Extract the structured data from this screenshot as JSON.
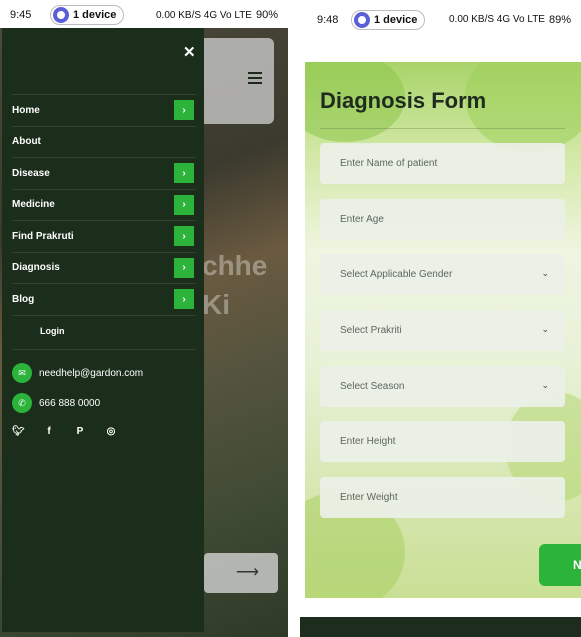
{
  "left": {
    "status": {
      "time": "9:45",
      "device": "1 device",
      "signal": "0.00 KB/S  4G  Vo  LTE",
      "battery": "90%"
    },
    "drawer": {
      "close_icon": "close-icon",
      "items": [
        {
          "label": "Home",
          "has_chevron": true
        },
        {
          "label": "About",
          "has_chevron": false
        },
        {
          "label": "Disease",
          "has_chevron": true
        },
        {
          "label": "Medicine",
          "has_chevron": true
        },
        {
          "label": "Find Prakruti",
          "has_chevron": true
        },
        {
          "label": "Diagnosis",
          "has_chevron": true
        },
        {
          "label": "Blog",
          "has_chevron": true
        }
      ],
      "chevron_glyph": "›",
      "login": "Login",
      "email": "needhelp@gardon.com",
      "phone": "666 888 0000",
      "socials": [
        "twitter-icon",
        "facebook-icon",
        "pinterest-icon",
        "instagram-icon"
      ]
    },
    "background_text": "chhe\nKi",
    "accent": "#2bb33a",
    "drawer_color": "#1b2d1b"
  },
  "right": {
    "status": {
      "time": "9:48",
      "device": "1 device",
      "signal": "0.00 KB/S  4G  Vo  LTE",
      "battery": "89%"
    },
    "form": {
      "title": "Diagnosis Form",
      "fields": [
        {
          "placeholder": "Enter Name of patient",
          "type": "input"
        },
        {
          "placeholder": "Enter Age",
          "type": "input"
        },
        {
          "placeholder": "Select Applicable Gender",
          "type": "select"
        },
        {
          "placeholder": "Select Prakriti",
          "type": "select"
        },
        {
          "placeholder": "Select Season",
          "type": "select"
        },
        {
          "placeholder": "Enter Height",
          "type": "input"
        },
        {
          "placeholder": "Enter Weight",
          "type": "input"
        }
      ],
      "next_label": "N"
    }
  }
}
